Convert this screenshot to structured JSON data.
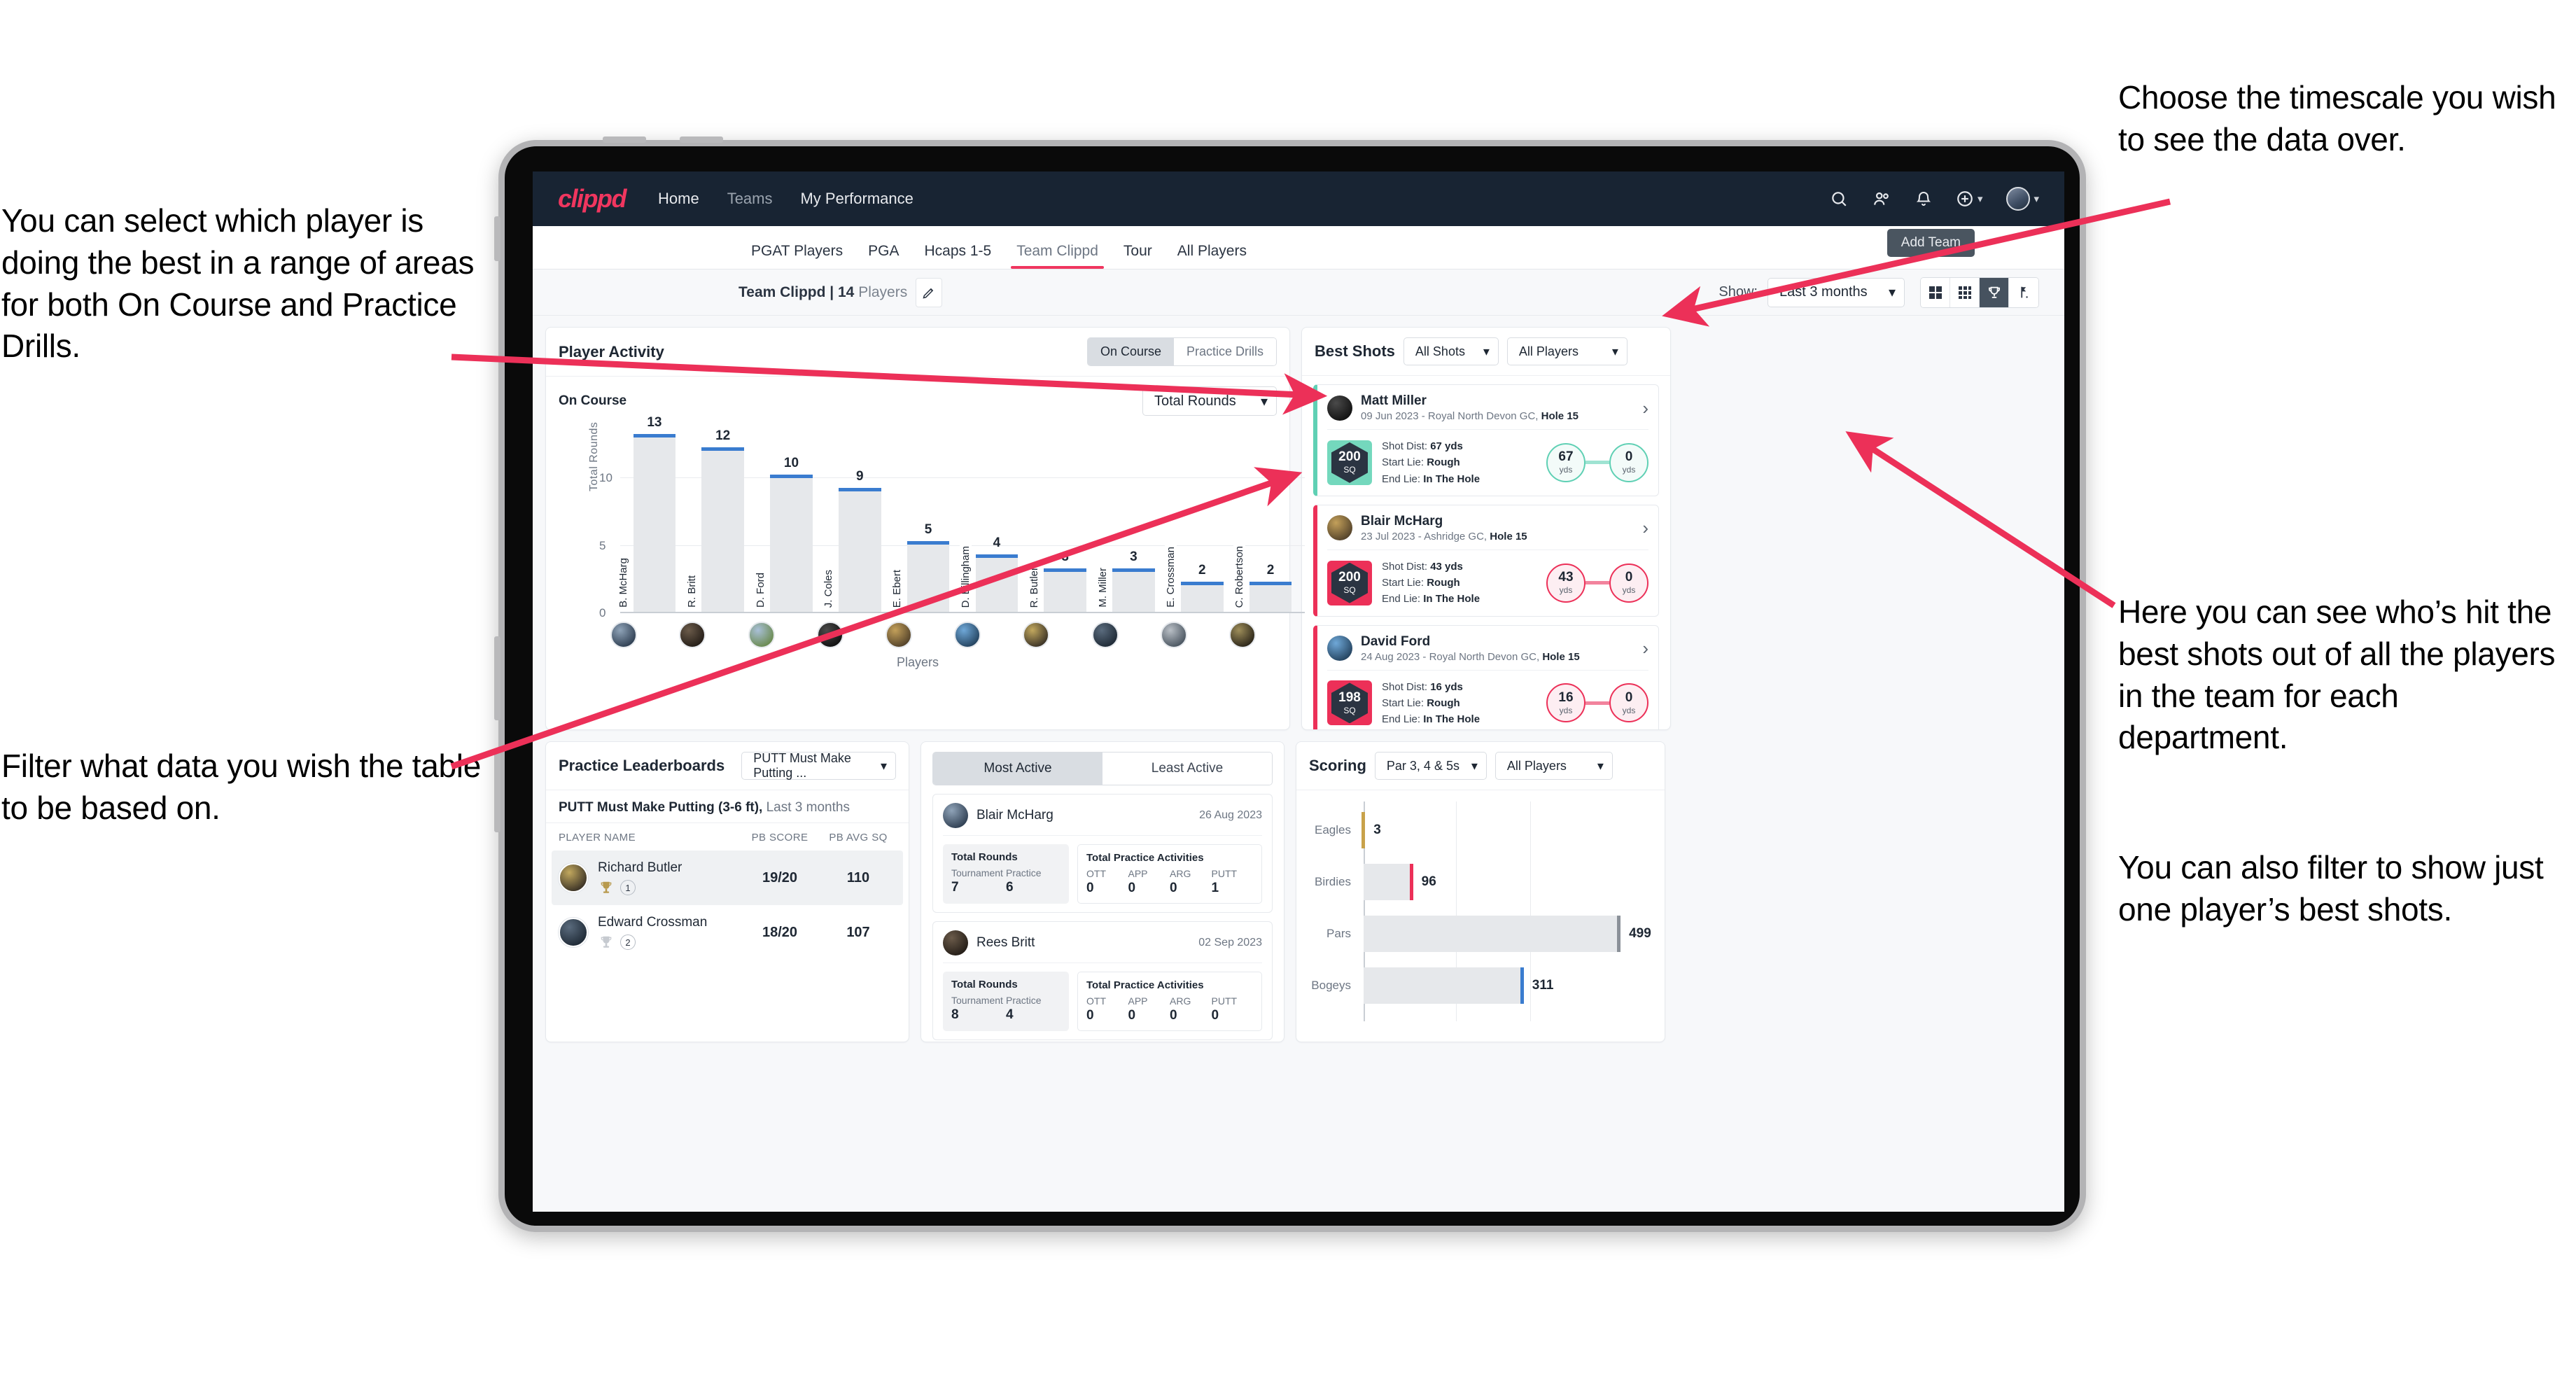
{
  "annotations": {
    "left_top": "You can select which player is doing the best in a range of areas for both On Course and Practice Drills.",
    "left_bottom": "Filter what data you wish the table to be based on.",
    "right_top": "Choose the timescale you wish to see the data over.",
    "right_mid": "Here you can see who’s hit the best shots out of all the players in the team for each department.",
    "right_bottom": "You can also filter to show just one player’s best shots."
  },
  "navbar": {
    "brand": "clippd",
    "links": [
      {
        "label": "Home",
        "active": true
      },
      {
        "label": "Teams",
        "active": false
      },
      {
        "label": "My Performance",
        "active": true
      }
    ],
    "icons": [
      "search-icon",
      "people-icon",
      "bell-icon",
      "plus-circle-icon",
      "avatar"
    ]
  },
  "tabs": {
    "items": [
      {
        "label": "PGAT Players",
        "active": false
      },
      {
        "label": "PGA",
        "active": false
      },
      {
        "label": "Hcaps 1-5",
        "active": false
      },
      {
        "label": "Team Clippd",
        "active": true
      },
      {
        "label": "Tour",
        "active": false
      },
      {
        "label": "All Players",
        "active": false
      }
    ],
    "tooltip": "Add Team"
  },
  "toolbar": {
    "team_name": "Team Clippd",
    "separator": " | ",
    "player_count": "14",
    "players_word": " Players",
    "show_label": "Show:",
    "period_value": "Last 3 months",
    "view_icons": [
      "grid-2x2-icon",
      "grid-3x3-icon",
      "trophy-icon",
      "golf-flag-icon"
    ],
    "view_active_index": 2
  },
  "player_activity": {
    "title": "Player Activity",
    "segments": [
      {
        "label": "On Course",
        "active": true
      },
      {
        "label": "Practice Drills",
        "active": false
      }
    ],
    "sub_label": "On Course",
    "metric_value": "Total Rounds"
  },
  "chart_data": {
    "type": "bar",
    "title": "Player Activity",
    "xlabel": "Players",
    "ylabel": "Total Rounds",
    "categories": [
      "B. McHarg",
      "R. Britt",
      "D. Ford",
      "J. Coles",
      "E. Ebert",
      "D. Billingham",
      "R. Butler",
      "M. Miller",
      "E. Crossman",
      "C. Robertson"
    ],
    "values": [
      13,
      12,
      10,
      9,
      5,
      4,
      3,
      3,
      2,
      2
    ],
    "yticks": [
      0,
      5,
      10
    ],
    "ylim": [
      0,
      14
    ],
    "grid": true,
    "bar_color": "#e6e8eb",
    "cap_color": "#3a7ccf"
  },
  "best_shots": {
    "title": "Best Shots",
    "filter_shots": "All Shots",
    "filter_players": "All Players",
    "items": [
      {
        "name": "Matt Miller",
        "meta_date": "09 Jun 2023 - Royal North Devon GC, ",
        "meta_hole": "Hole 15",
        "badge_value": "200",
        "badge_unit": "SQ",
        "accent": "teal",
        "shot_dist_label": "Shot Dist: ",
        "shot_dist_value": "67 yds",
        "start_lie_label": "Start Lie: ",
        "start_lie_value": "Rough",
        "end_lie_label": "End Lie: ",
        "end_lie_value": "In The Hole",
        "from_value": "67",
        "from_unit": "yds",
        "to_value": "0",
        "to_unit": "yds"
      },
      {
        "name": "Blair McHarg",
        "meta_date": "23 Jul 2023 - Ashridge GC, ",
        "meta_hole": "Hole 15",
        "badge_value": "200",
        "badge_unit": "SQ",
        "accent": "pink",
        "shot_dist_label": "Shot Dist: ",
        "shot_dist_value": "43 yds",
        "start_lie_label": "Start Lie: ",
        "start_lie_value": "Rough",
        "end_lie_label": "End Lie: ",
        "end_lie_value": "In The Hole",
        "from_value": "43",
        "from_unit": "yds",
        "to_value": "0",
        "to_unit": "yds"
      },
      {
        "name": "David Ford",
        "meta_date": "24 Aug 2023 - Royal North Devon GC, ",
        "meta_hole": "Hole 15",
        "badge_value": "198",
        "badge_unit": "SQ",
        "accent": "pink",
        "shot_dist_label": "Shot Dist: ",
        "shot_dist_value": "16 yds",
        "start_lie_label": "Start Lie: ",
        "start_lie_value": "Rough",
        "end_lie_label": "End Lie: ",
        "end_lie_value": "In The Hole",
        "from_value": "16",
        "from_unit": "yds",
        "to_value": "0",
        "to_unit": "yds"
      }
    ]
  },
  "practice_leaderboards": {
    "title": "Practice Leaderboards",
    "drill_select": "PUTT Must Make Putting ...",
    "subtitle_bold": "PUTT Must Make Putting (3-6 ft),",
    "subtitle_muted": " Last 3 months",
    "columns": [
      "PLAYER NAME",
      "PB SCORE",
      "PB AVG SQ"
    ],
    "rows": [
      {
        "name": "Richard Butler",
        "rank": "1",
        "trophy": "gold",
        "pb_score": "19/20",
        "pb_avg_sq": "110",
        "highlight": true
      },
      {
        "name": "Edward Crossman",
        "rank": "2",
        "trophy": "silver",
        "pb_score": "18/20",
        "pb_avg_sq": "107",
        "highlight": false
      }
    ]
  },
  "activity": {
    "tabs": [
      {
        "label": "Most Active",
        "active": true
      },
      {
        "label": "Least Active",
        "active": false
      }
    ],
    "cards": [
      {
        "name": "Blair McHarg",
        "date": "26 Aug 2023",
        "rounds_title": "Total Rounds",
        "rounds_keys": [
          "Tournament",
          "Practice"
        ],
        "rounds_values": [
          "7",
          "6"
        ],
        "practice_title": "Total Practice Activities",
        "practice_keys": [
          "OTT",
          "APP",
          "ARG",
          "PUTT"
        ],
        "practice_values": [
          "0",
          "0",
          "0",
          "1"
        ]
      },
      {
        "name": "Rees Britt",
        "date": "02 Sep 2023",
        "rounds_title": "Total Rounds",
        "rounds_keys": [
          "Tournament",
          "Practice"
        ],
        "rounds_values": [
          "8",
          "4"
        ],
        "practice_title": "Total Practice Activities",
        "practice_keys": [
          "OTT",
          "APP",
          "ARG",
          "PUTT"
        ],
        "practice_values": [
          "0",
          "0",
          "0",
          "0"
        ]
      }
    ]
  },
  "scoring": {
    "title": "Scoring",
    "filter_par": "Par 3, 4 & 5s",
    "filter_players": "All Players",
    "chart": {
      "type": "bar",
      "orientation": "horizontal",
      "categories": [
        "Eagles",
        "Birdies",
        "Pars",
        "Bogeys"
      ],
      "values": [
        3,
        96,
        499,
        311
      ],
      "cap_colors": [
        "#c8a24a",
        "#ec3058",
        "#8b9199",
        "#3a7ccf"
      ],
      "xmax": 560,
      "grid": true
    }
  },
  "colors": {
    "brand_pink": "#f0365f",
    "nav_dark": "#182433",
    "teal": "#5fd0b4",
    "blue": "#3a7ccf"
  }
}
